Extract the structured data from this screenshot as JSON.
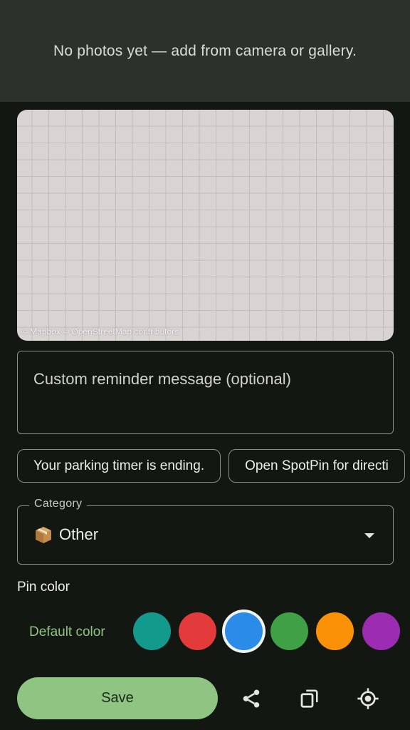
{
  "photos": {
    "empty_message": "No photos yet — add from camera or gallery."
  },
  "map": {
    "attribution": "© Mapbox © OpenStreetMap contributors"
  },
  "reminder": {
    "placeholder": "Custom reminder message (optional)",
    "value": ""
  },
  "suggestion_chips": [
    {
      "label": "Your parking timer is ending."
    },
    {
      "label": "Open SpotPin for directi"
    }
  ],
  "category": {
    "label": "Category",
    "selected_icon": "package-icon",
    "selected_value": "Other"
  },
  "pin_color": {
    "label": "Pin color",
    "default_label": "Default color",
    "selected_index": 2,
    "swatches": [
      "#139a8c",
      "#e33b3b",
      "#2a8be8",
      "#3fa046",
      "#fb9107",
      "#9c2db3"
    ]
  },
  "actions": {
    "save_label": "Save",
    "icons": [
      "share-icon",
      "copy-icon",
      "my-location-icon"
    ]
  },
  "colors": {
    "accent": "#8fc482",
    "background": "#121712",
    "banner": "#2b3229"
  }
}
